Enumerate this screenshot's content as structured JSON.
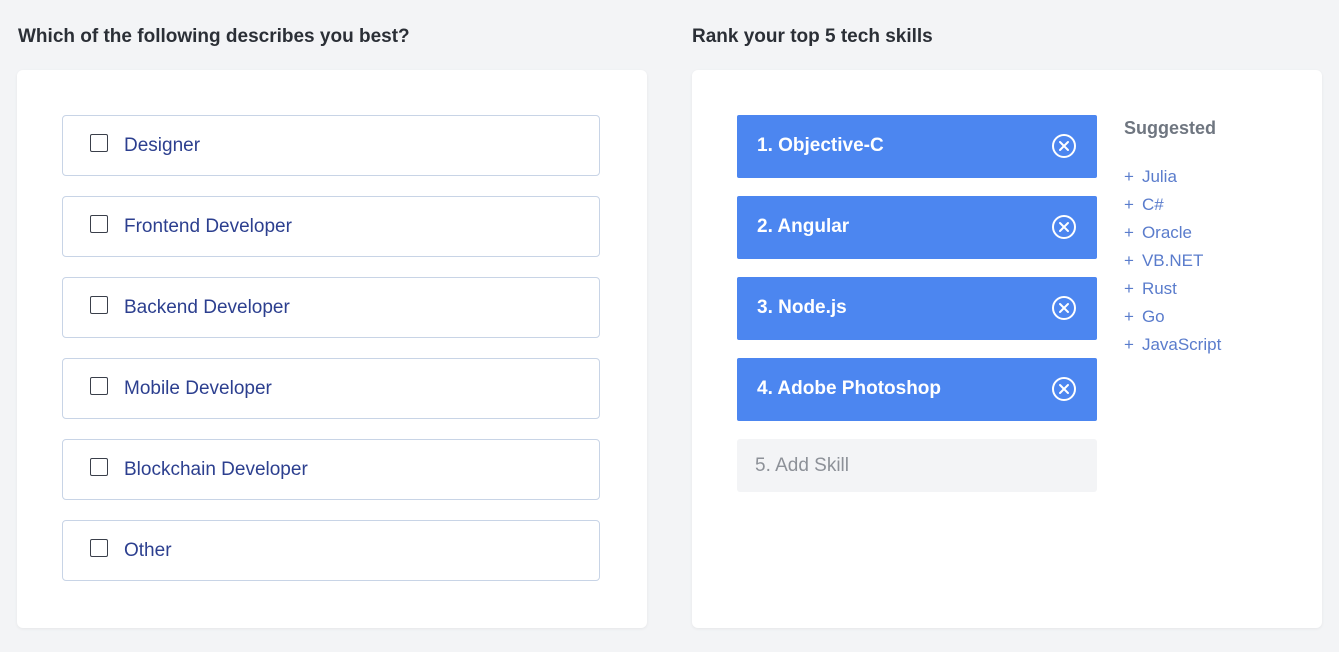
{
  "left_section": {
    "title": "Which of the following describes you best?",
    "options": [
      {
        "label": "Designer",
        "checked": false
      },
      {
        "label": "Frontend Developer",
        "checked": false
      },
      {
        "label": "Backend Developer",
        "checked": false
      },
      {
        "label": "Mobile Developer",
        "checked": false
      },
      {
        "label": "Blockchain Developer",
        "checked": false
      },
      {
        "label": "Other",
        "checked": false
      }
    ]
  },
  "right_section": {
    "title": "Rank your top 5 tech skills",
    "skills": [
      {
        "label": "1. Objective-C"
      },
      {
        "label": "2. Angular"
      },
      {
        "label": "3. Node.js"
      },
      {
        "label": "4. Adobe Photoshop"
      }
    ],
    "add_skill_placeholder": "5. Add Skill",
    "suggested_title": "Suggested",
    "suggested": [
      {
        "plus": "+",
        "label": "Julia"
      },
      {
        "plus": "+",
        "label": "C#"
      },
      {
        "plus": "+",
        "label": "Oracle"
      },
      {
        "plus": "+",
        "label": "VB.NET"
      },
      {
        "plus": "+",
        "label": "Rust"
      },
      {
        "plus": "+",
        "label": "Go"
      },
      {
        "plus": "+",
        "label": "JavaScript"
      }
    ]
  },
  "colors": {
    "accent": "#4c86f0",
    "option_text": "#2c3f8f",
    "suggested_link": "#5a7ccc"
  }
}
